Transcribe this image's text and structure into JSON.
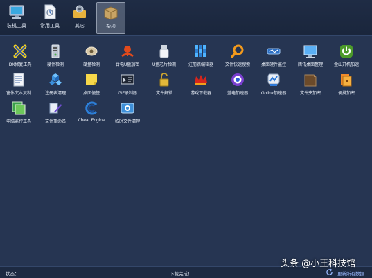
{
  "toolbar": {
    "items": [
      {
        "label": "装机工具"
      },
      {
        "label": "常用工具"
      },
      {
        "label": "其它"
      },
      {
        "label": "杂项"
      }
    ]
  },
  "tools": [
    {
      "label": "DX修复工具"
    },
    {
      "label": "硬件检测"
    },
    {
      "label": "硬盘检测"
    },
    {
      "label": "台电U盘加密"
    },
    {
      "label": "U盘芯片检测"
    },
    {
      "label": "注册表编辑器"
    },
    {
      "label": "文件快速搜索"
    },
    {
      "label": "桌面硬件监控"
    },
    {
      "label": "腾讯桌面整理"
    },
    {
      "label": "金山开机加速"
    },
    {
      "label": "窗体文本复制"
    },
    {
      "label": "注册表清理"
    },
    {
      "label": "桌面便签"
    },
    {
      "label": "GIF录制器"
    },
    {
      "label": "文件解锁"
    },
    {
      "label": "游戏下载器"
    },
    {
      "label": "蓝电加速器"
    },
    {
      "label": "Golink加速器"
    },
    {
      "label": "文件夹加密"
    },
    {
      "label": "便携加密"
    },
    {
      "label": "电脑监控工具"
    },
    {
      "label": "文件重命名"
    },
    {
      "label": "Cheat Engine"
    },
    {
      "label": "临时文件清理"
    }
  ],
  "status": {
    "label": "状态：",
    "message": "下载完成！",
    "refresh_link": "更新所有数据"
  },
  "watermark": {
    "text": "头条 @小王科技馆"
  }
}
